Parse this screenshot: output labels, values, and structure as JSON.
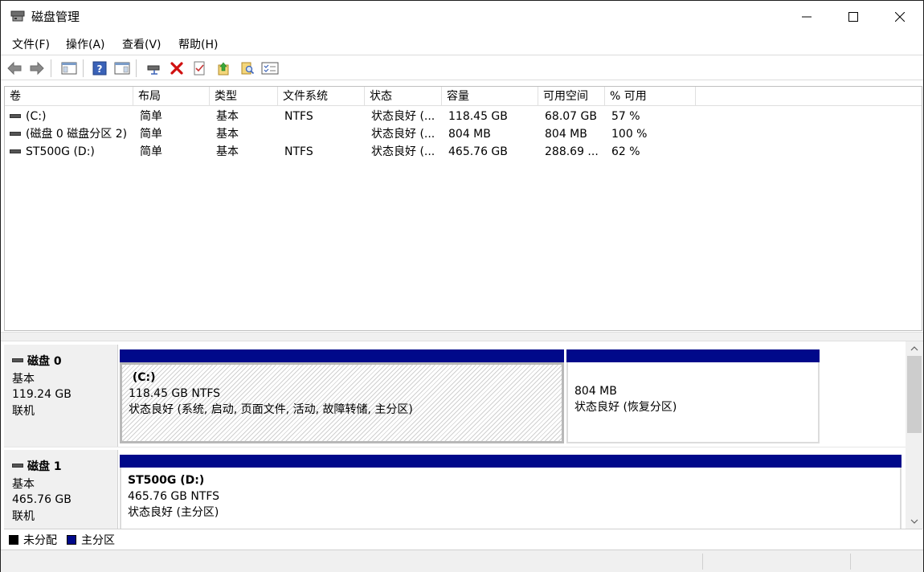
{
  "window": {
    "title": "磁盘管理"
  },
  "menu": [
    {
      "label": "文件(F)"
    },
    {
      "label": "操作(A)"
    },
    {
      "label": "查看(V)"
    },
    {
      "label": "帮助(H)"
    }
  ],
  "toolbar": {
    "icons": [
      "back-arrow-icon",
      "forward-arrow-icon",
      "console-tree-icon",
      "help-icon",
      "action-pane-icon",
      "connect-disk-icon",
      "delete-icon",
      "properties-icon",
      "export-icon",
      "search-icon",
      "customize-view-icon"
    ]
  },
  "volume_list": {
    "columns": [
      "卷",
      "布局",
      "类型",
      "文件系统",
      "状态",
      "容量",
      "可用空间",
      "% 可用"
    ],
    "rows": [
      {
        "volume": "(C:)",
        "layout": "简单",
        "type": "基本",
        "fs": "NTFS",
        "status": "状态良好 (...",
        "capacity": "118.45 GB",
        "free": "68.07 GB",
        "pct": "57 %"
      },
      {
        "volume": "(磁盘 0 磁盘分区 2)",
        "layout": "简单",
        "type": "基本",
        "fs": "",
        "status": "状态良好 (...",
        "capacity": "804 MB",
        "free": "804 MB",
        "pct": "100 %"
      },
      {
        "volume": "ST500G (D:)",
        "layout": "简单",
        "type": "基本",
        "fs": "NTFS",
        "status": "状态良好 (...",
        "capacity": "465.76 GB",
        "free": "288.69 ...",
        "pct": "62 %"
      }
    ]
  },
  "disks": [
    {
      "name": "磁盘 0",
      "type": "基本",
      "size": "119.24 GB",
      "state": "联机",
      "partitions": [
        {
          "title": "(C:)",
          "size": "118.45 GB NTFS",
          "status": "状态良好 (系统, 启动, 页面文件, 活动, 故障转储, 主分区)"
        },
        {
          "title": "",
          "size": "804 MB",
          "status": "状态良好 (恢复分区)"
        }
      ]
    },
    {
      "name": "磁盘 1",
      "type": "基本",
      "size": "465.76 GB",
      "state": "联机",
      "partitions": [
        {
          "title": "ST500G  (D:)",
          "size": "465.76 GB NTFS",
          "status": "状态良好 (主分区)"
        }
      ]
    }
  ],
  "legend": [
    {
      "label": "未分配",
      "color": "#000000"
    },
    {
      "label": "主分区",
      "color": "#00098a"
    }
  ]
}
